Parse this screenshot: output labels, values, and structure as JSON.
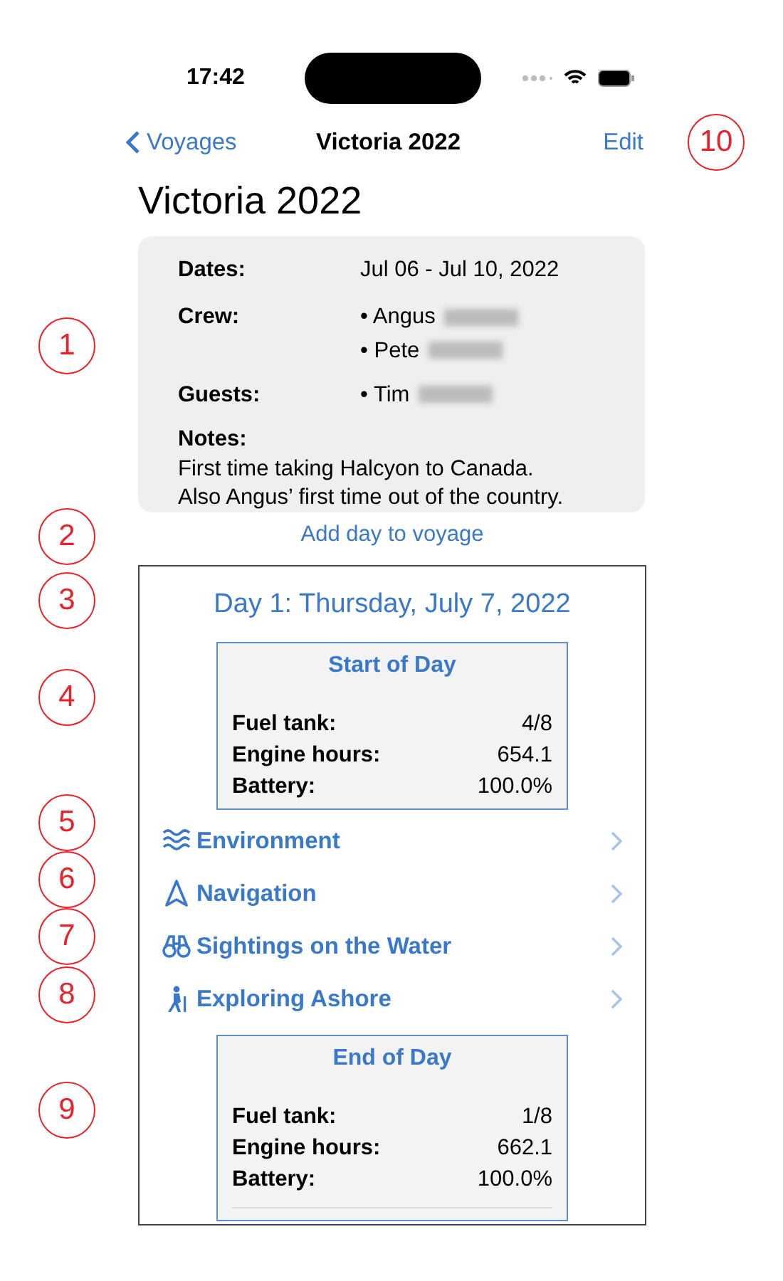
{
  "status_bar": {
    "time": "17:42"
  },
  "nav_bar": {
    "back": "Voyages",
    "title": "Victoria 2022",
    "action": "Edit"
  },
  "title": "Victoria 2022",
  "summary": [
    {
      "label": "Dates:",
      "kind": "text",
      "value": "Jul 06 - Jul 10, 2022"
    },
    {
      "label": "Crew:",
      "kind": "list",
      "bullet": "•",
      "items": [
        {
          "name": "Angus",
          "redacted": true
        },
        {
          "name": "Pete",
          "redacted": true
        }
      ]
    },
    {
      "label": "Guests:",
      "kind": "list",
      "bullet": "•",
      "items": [
        {
          "name": "Tim",
          "redacted": true
        }
      ]
    },
    {
      "label": "Notes:",
      "kind": "notes",
      "lines": [
        "First time taking Halcyon to Canada.",
        "Also Angus’ first time out of the country."
      ]
    }
  ],
  "add_day": "Add day to voyage",
  "day": {
    "title": "Day 1: Thursday, July 7, 2022",
    "start": {
      "title": "Start of Day",
      "rows": [
        {
          "label": "Fuel tank:",
          "value": "4/8"
        },
        {
          "label": "Engine hours:",
          "value": "654.1"
        },
        {
          "label": "Battery:",
          "value": "100.0%"
        }
      ]
    },
    "sections": [
      {
        "kind": "waves",
        "label": "Environment"
      },
      {
        "kind": "navigation",
        "label": "Navigation"
      },
      {
        "kind": "binoculars",
        "label": "Sightings on the Water"
      },
      {
        "kind": "hiker",
        "label": "Exploring Ashore"
      }
    ],
    "end": {
      "title": "End of Day",
      "rows": [
        {
          "label": "Fuel tank:",
          "value": "1/8"
        },
        {
          "label": "Engine hours:",
          "value": "662.1"
        },
        {
          "label": "Battery:",
          "value": "100.0%"
        }
      ]
    }
  },
  "callouts": [
    "1",
    "2",
    "3",
    "4",
    "5",
    "6",
    "7",
    "8",
    "9",
    "10"
  ]
}
